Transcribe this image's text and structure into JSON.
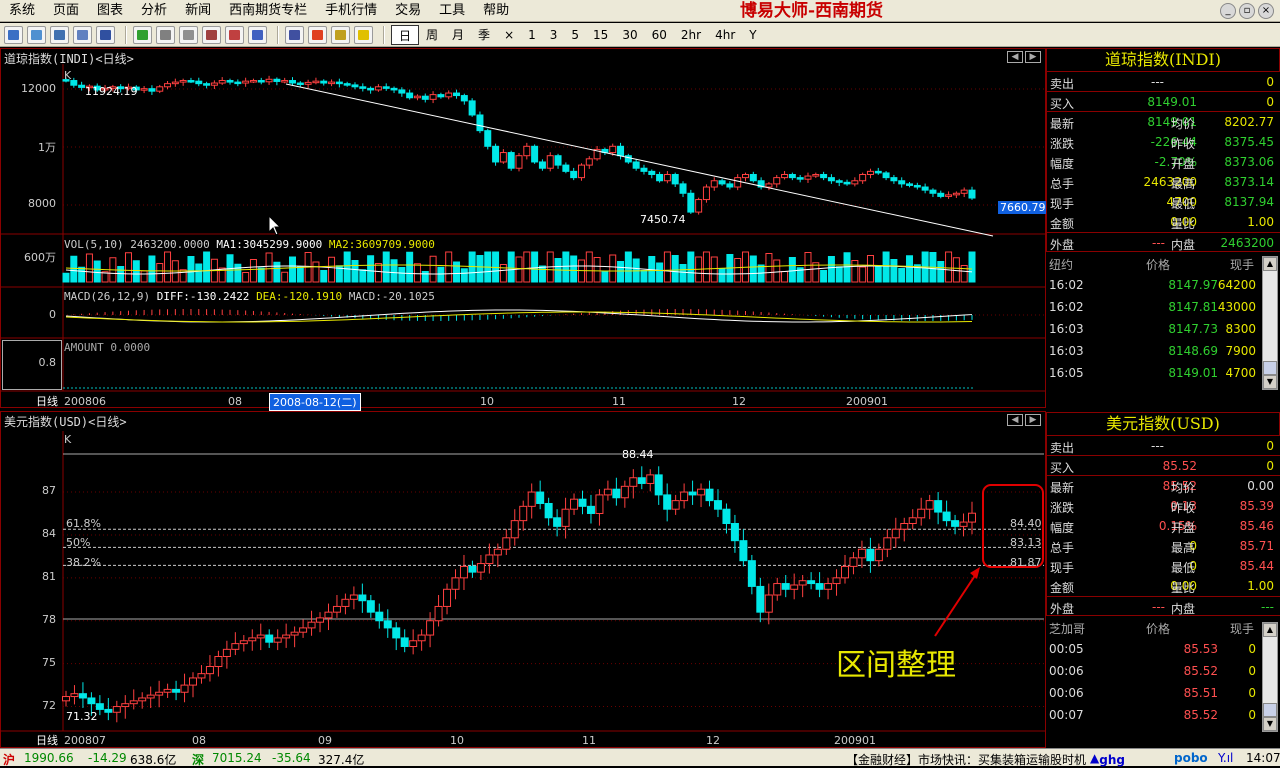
{
  "menubar": {
    "items": [
      "系统",
      "页面",
      "图表",
      "分析",
      "新闻",
      "西南期货专栏",
      "手机行情",
      "交易",
      "工具",
      "帮助"
    ],
    "brand": "博易大师-西南期货"
  },
  "toolbar": {
    "periods": [
      "日",
      "周",
      "月",
      "季",
      "×",
      "1",
      "3",
      "5",
      "15",
      "30",
      "60",
      "2hr",
      "4hr",
      "Y"
    ],
    "active": "日"
  },
  "top_chart": {
    "title": "道琼指数(INDI)<日线>",
    "k_label": "K",
    "price_ticks": [
      "12000",
      "1万",
      "8000"
    ],
    "vol_tick": "600万",
    "macd_tick": "0",
    "amount_tick": "0.8",
    "high_label": "11924.19",
    "low_label": "7450.74",
    "last_price_badge": "7660.79",
    "vol_title": "VOL(5,10) 2463200.0000",
    "vol_ma1": "MA1:3045299.9000",
    "vol_ma2": "MA2:3609709.9000",
    "macd_title": "MACD(26,12,9)",
    "macd_diff": "DIFF:-130.2422",
    "macd_dea": "DEA:-120.1910",
    "macd_val": "MACD:-20.1025",
    "amount_title": "AMOUNT 0.0000",
    "axis_label": "日线",
    "x_labels": [
      "200806",
      "08",
      "10",
      "11",
      "12",
      "200901"
    ],
    "cursor_date": "2008-08-12(二)"
  },
  "bottom_chart": {
    "title": "美元指数(USD)<日线>",
    "k_label": "K",
    "price_ticks": [
      "87",
      "84",
      "81",
      "78",
      "75",
      "72"
    ],
    "high_label": "88.44",
    "low_label": "71.32",
    "fib_labels": [
      "61.8%",
      "50%",
      "38.2%"
    ],
    "fib_values": [
      "84.40",
      "83.13",
      "81.87"
    ],
    "axis_label": "日线",
    "x_labels": [
      "200807",
      "08",
      "09",
      "10",
      "11",
      "12",
      "200901"
    ],
    "annotation": "区间整理"
  },
  "quote_top": {
    "title": "道琼指数(INDI)",
    "sell": {
      "label": "卖出",
      "price": "---",
      "vol": "0"
    },
    "buy": {
      "label": "买入",
      "price": "8149.01",
      "vol": "0"
    },
    "rows": [
      {
        "l1": "最新",
        "v1": "8149.01",
        "l2": "均价",
        "v2": "8202.77"
      },
      {
        "l1": "涨跌",
        "v1": "-226.44",
        "l2": "昨收",
        "v2": "8375.45"
      },
      {
        "l1": "幅度",
        "v1": "-2.70%",
        "l2": "开盘",
        "v2": "8373.06"
      },
      {
        "l1": "总手",
        "v1": "2463200",
        "l2": "最高",
        "v2": "8373.14"
      },
      {
        "l1": "现手",
        "v1": "4700",
        "l2": "最低",
        "v2": "8137.94"
      },
      {
        "l1": "金额",
        "v1": "0.00",
        "l2": "量比",
        "v2": "1.00"
      }
    ],
    "outer": {
      "label": "外盘",
      "value": "---",
      "label2": "内盘",
      "value2": "2463200"
    },
    "tick_header": {
      "col1": "纽约",
      "col2": "价格",
      "col3": "现手"
    },
    "ticks": [
      {
        "time": "16:02",
        "price": "8147.97",
        "vol": "64200"
      },
      {
        "time": "16:02",
        "price": "8147.81",
        "vol": "43000"
      },
      {
        "time": "16:03",
        "price": "8147.73",
        "vol": "8300"
      },
      {
        "time": "16:03",
        "price": "8148.69",
        "vol": "7900"
      },
      {
        "time": "16:05",
        "price": "8149.01",
        "vol": "4700"
      }
    ]
  },
  "quote_bottom": {
    "title": "美元指数(USD)",
    "sell": {
      "label": "卖出",
      "price": "---",
      "vol": "0"
    },
    "buy": {
      "label": "买入",
      "price": "85.52",
      "vol": "0"
    },
    "rows": [
      {
        "l1": "最新",
        "v1": "85.52",
        "l2": "均价",
        "v2": "0.00"
      },
      {
        "l1": "涨跌",
        "v1": "0.13",
        "l2": "昨收",
        "v2": "85.39"
      },
      {
        "l1": "幅度",
        "v1": "0.15%",
        "l2": "开盘",
        "v2": "85.46"
      },
      {
        "l1": "总手",
        "v1": "0",
        "l2": "最高",
        "v2": "85.71"
      },
      {
        "l1": "现手",
        "v1": "0",
        "l2": "最低",
        "v2": "85.44"
      },
      {
        "l1": "金额",
        "v1": "0.00",
        "l2": "量比",
        "v2": "1.00"
      }
    ],
    "outer": {
      "label": "外盘",
      "value": "---",
      "label2": "内盘",
      "value2": "---"
    },
    "tick_header": {
      "col1": "芝加哥",
      "col2": "价格",
      "col3": "现手"
    },
    "ticks": [
      {
        "time": "00:05",
        "price": "85.53",
        "vol": "0"
      },
      {
        "time": "00:06",
        "price": "85.52",
        "vol": "0"
      },
      {
        "time": "00:06",
        "price": "85.51",
        "vol": "0"
      },
      {
        "time": "00:07",
        "price": "85.52",
        "vol": "0"
      }
    ]
  },
  "statusbar": {
    "sh_label": "沪",
    "sh_index": "1990.66",
    "sh_change": "-14.29",
    "sh_amount": "638.6亿",
    "sz_label": "深",
    "sz_index": "7015.24",
    "sz_change": "-35.64",
    "sz_amount": "327.4亿",
    "news": "【金融财经】市场快讯：买集装箱运输股时机",
    "user": "ghg",
    "logo": "pobo",
    "time": "14:07"
  },
  "chart_data": [
    {
      "type": "candlestick",
      "title": "道琼指数(INDI)<日线>",
      "x_range": [
        "200806",
        "200901"
      ],
      "y_range": [
        7000,
        12300
      ],
      "high": 11924.19,
      "low": 7450.74,
      "last": 7660.79,
      "closes": [
        11900,
        11750,
        11680,
        11720,
        11600,
        11650,
        11700,
        11640,
        11690,
        11600,
        11640,
        11560,
        11700,
        11800,
        11850,
        11900,
        11880,
        11800,
        11750,
        11820,
        11900,
        11850,
        11820,
        11880,
        11900,
        11860,
        11940,
        11870,
        11900,
        11820,
        11780,
        11840,
        11880,
        11820,
        11850,
        11800,
        11760,
        11700,
        11650,
        11600,
        11700,
        11650,
        11600,
        11500,
        11350,
        11400,
        11300,
        11450,
        11380,
        11500,
        11420,
        11250,
        10800,
        10300,
        9800,
        9300,
        9600,
        9100,
        9500,
        9800,
        9300,
        9100,
        9500,
        9200,
        9000,
        8800,
        9200,
        9400,
        9700,
        9600,
        9800,
        9500,
        9300,
        9100,
        9000,
        8900,
        8700,
        8900,
        8600,
        8300,
        7700,
        8100,
        8500,
        8700,
        8600,
        8500,
        8800,
        8900,
        8700,
        8500,
        8600,
        8800,
        8900,
        8800,
        8750,
        8850,
        8900,
        8800,
        8700,
        8650,
        8600,
        8700,
        8900,
        9000,
        8950,
        8800,
        8700,
        8600,
        8550,
        8500,
        8400,
        8300,
        8200,
        8250,
        8300,
        8400,
        8149
      ]
    },
    {
      "type": "candlestick",
      "title": "美元指数(USD)<日线>",
      "x_range": [
        "200807",
        "200901"
      ],
      "y_range": [
        70.5,
        89.8
      ],
      "high": 88.44,
      "low": 71.32,
      "fib_levels": {
        "61.8%": 84.4,
        "50%": 83.13,
        "38.2%": 81.87
      },
      "closes": [
        72.7,
        72.9,
        72.6,
        72.2,
        71.8,
        71.6,
        72.0,
        72.2,
        72.4,
        72.6,
        72.8,
        73.0,
        73.2,
        73.0,
        73.5,
        74.0,
        74.3,
        74.8,
        75.5,
        76.0,
        76.4,
        76.6,
        76.8,
        77.0,
        76.5,
        76.8,
        77.0,
        77.2,
        77.5,
        77.9,
        78.2,
        78.6,
        79.0,
        79.5,
        79.8,
        79.4,
        78.6,
        78.0,
        77.5,
        76.8,
        76.2,
        76.6,
        77.0,
        78.0,
        79.0,
        80.2,
        81.0,
        81.8,
        81.4,
        82.0,
        82.6,
        83.0,
        83.8,
        85.0,
        86.0,
        87.0,
        86.2,
        85.2,
        84.6,
        85.8,
        86.5,
        86.0,
        85.5,
        86.8,
        87.2,
        86.6,
        87.4,
        88.0,
        87.6,
        88.2,
        86.8,
        85.8,
        86.4,
        87.0,
        86.8,
        87.2,
        86.4,
        85.8,
        84.8,
        83.6,
        82.2,
        80.4,
        78.6,
        79.8,
        80.6,
        80.2,
        80.5,
        80.8,
        80.6,
        80.2,
        80.6,
        81.0,
        81.8,
        82.4,
        83.0,
        82.2,
        83.0,
        83.8,
        84.4,
        84.8,
        85.2,
        85.8,
        86.4,
        85.6,
        85.0,
        84.6,
        84.9,
        85.52
      ]
    }
  ]
}
